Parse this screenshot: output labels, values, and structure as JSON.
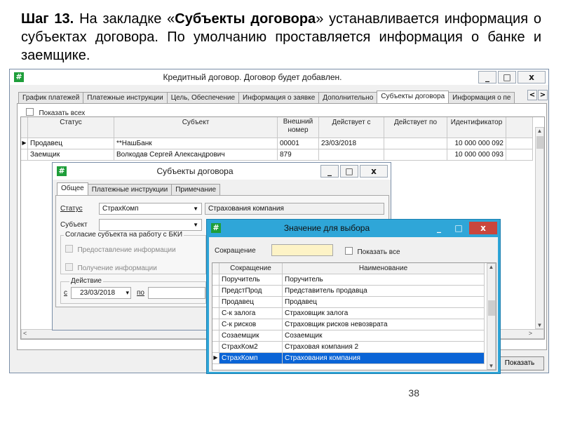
{
  "slide": {
    "heading_step": "Шаг 13.",
    "heading_before": " На закладке «",
    "heading_bold": "Субъекты договора",
    "heading_after": "» устанавливается информация о субъектах договора. По умолчанию проставляется информация о банке и заемщике.",
    "page_number": "38"
  },
  "main_window": {
    "icon": "#",
    "title": "Кредитный договор. Договор будет добавлен.",
    "minimize": "_",
    "maximize": "□",
    "close": "x",
    "tabs": [
      "График платежей",
      "Платежные инструкции",
      "Цель, Обеспечение",
      "Информация о заявке",
      "Дополнительно",
      "Субъекты договора",
      "Информация о пе"
    ],
    "active_tab": 5,
    "tab_scroll_left": "<",
    "tab_scroll_right": ">",
    "show_all_label": "Показать всех",
    "columns": [
      "Статус",
      "Субъект",
      "Внешний номер",
      "Действует с",
      "Действует по",
      "Идентификатор"
    ],
    "rows": [
      [
        "Продавец",
        "**НашБанк",
        "00001",
        "23/03/2018",
        "",
        "10 000 000 092"
      ],
      [
        "Заемщик",
        "Волкодав Сергей Александрович",
        "879",
        "",
        "",
        "10 000 000 093"
      ]
    ],
    "show_button": "Показать"
  },
  "subjects_dialog": {
    "icon": "#",
    "title": "Субъекты договора",
    "minimize": "_",
    "maximize": "□",
    "close": "x",
    "tabs": [
      "Общее",
      "Платежные инструкции",
      "Примечание"
    ],
    "status_label": "Статус",
    "status_value": "СтрахКомп",
    "status_name": "Страхования компания",
    "subject_label": "Субъект",
    "subject_value": "",
    "consent_group": "Согласие субъекта на работу с БКИ",
    "provide_info": "Предоставление информации",
    "receive_info": "Получение информации",
    "action_group": "Действие",
    "from_label": "с",
    "from_value": "23/03/2018",
    "to_label": "по",
    "to_value": ""
  },
  "value_dialog": {
    "icon": "#",
    "title": "Значение для выбора",
    "minimize": "_",
    "maximize": "□",
    "close": "x",
    "abbr_label": "Сокращение",
    "abbr_value": "",
    "show_all_label": "Показать все",
    "columns": [
      "Сокращение",
      "Наименование"
    ],
    "rows": [
      [
        "Поручитель",
        "Поручитель"
      ],
      [
        "ПредстПрод",
        "Представитель продавца"
      ],
      [
        "Продавец",
        "Продавец"
      ],
      [
        "С-к залога",
        "Страховщик залога"
      ],
      [
        "С-к рисков",
        "Страховщик рисков невозврата"
      ],
      [
        "Созаемщик",
        "Созаемщик"
      ],
      [
        "СтрахКом2",
        "Страховая компания 2"
      ],
      [
        "СтрахКомп",
        "Страхования компания"
      ]
    ],
    "selected_row": 7
  }
}
